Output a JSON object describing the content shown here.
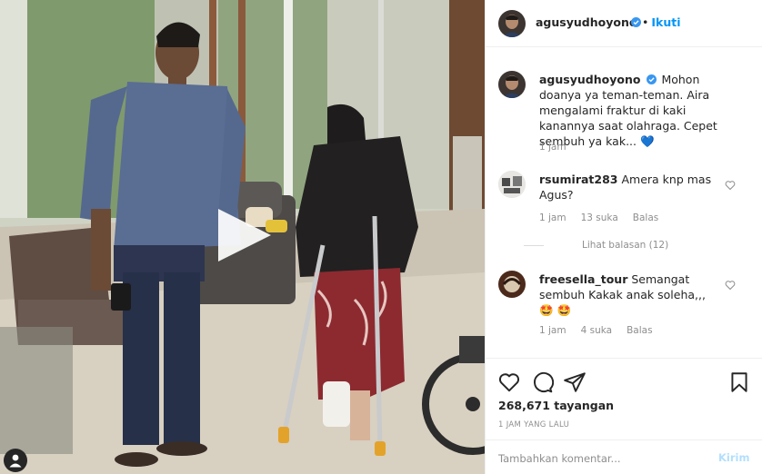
{
  "post": {
    "username": "agusyudhoyono",
    "follow_dot": "•",
    "follow_label": "Ikuti",
    "caption": "Mohon doanya ya teman-teman. Aira mengalami fraktur di kaki kanannya saat olahraga. Cepet sembuh ya kak...",
    "caption_emoji": "💙",
    "caption_time": "1 jam",
    "views": "268,671 tayangan",
    "time_ago": "1 JAM YANG LALU"
  },
  "comments": [
    {
      "username": "rsumirat283",
      "text": "Amera knp mas Agus?",
      "time": "1 jam",
      "likes": "13 suka",
      "reply_label": "Balas",
      "view_replies": "Lihat balasan (12)"
    },
    {
      "username": "freesella_tour",
      "text": "Semangat sembuh Kakak anak soleha,,,",
      "emoji": "🤩",
      "emoji2": "🤩",
      "time": "1 jam",
      "likes": "4 suka",
      "reply_label": "Balas"
    }
  ],
  "composer": {
    "placeholder": "Tambahkan komentar...",
    "post_label": "Kirim"
  },
  "colors": {
    "accent": "#0095f6",
    "verified": "#3897f0",
    "post_disabled": "#b2dffc",
    "muted": "#8e8e8e"
  },
  "icons": {
    "play": "play-icon",
    "audio": "user-tag-icon",
    "like": "heart-icon",
    "comment": "comment-icon",
    "share": "send-icon",
    "save": "bookmark-icon"
  }
}
